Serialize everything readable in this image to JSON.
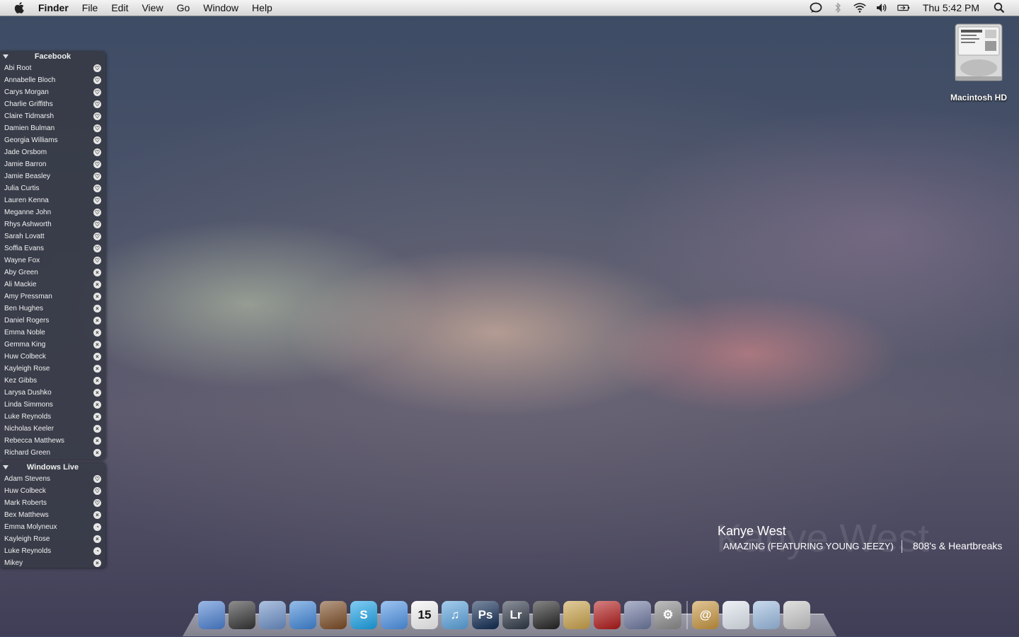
{
  "menubar": {
    "app_name": "Finder",
    "menus": [
      "File",
      "Edit",
      "View",
      "Go",
      "Window",
      "Help"
    ],
    "clock": "Thu 5:42 PM",
    "status_icons": [
      "chat-bubble-icon",
      "bluetooth-icon",
      "wifi-icon",
      "volume-icon",
      "battery-icon",
      "spotlight-search-icon"
    ]
  },
  "desktop": {
    "hd_label": "Macintosh HD"
  },
  "facebook": {
    "title": "Facebook",
    "contacts": [
      {
        "name": "Abi Root",
        "status": "online"
      },
      {
        "name": "Annabelle Bloch",
        "status": "online"
      },
      {
        "name": "Carys Morgan",
        "status": "online"
      },
      {
        "name": "Charlie Griffiths",
        "status": "online"
      },
      {
        "name": "Claire Tidmarsh",
        "status": "online"
      },
      {
        "name": "Damien Bulman",
        "status": "online"
      },
      {
        "name": "Georgia Williams",
        "status": "online"
      },
      {
        "name": "Jade Orsbom",
        "status": "online"
      },
      {
        "name": "Jamie Barron",
        "status": "online"
      },
      {
        "name": "Jamie Beasley",
        "status": "online"
      },
      {
        "name": "Julia Curtis",
        "status": "online"
      },
      {
        "name": "Lauren Kenna",
        "status": "online"
      },
      {
        "name": "Meganne John",
        "status": "online"
      },
      {
        "name": "Rhys Ashworth",
        "status": "online"
      },
      {
        "name": "Sarah Lovatt",
        "status": "online"
      },
      {
        "name": "Soffia Evans",
        "status": "online"
      },
      {
        "name": "Wayne Fox",
        "status": "online"
      },
      {
        "name": "Aby Green",
        "status": "offline"
      },
      {
        "name": "Ali Mackie",
        "status": "offline"
      },
      {
        "name": "Amy Pressman",
        "status": "offline"
      },
      {
        "name": "Ben Hughes",
        "status": "offline"
      },
      {
        "name": "Daniel Rogers",
        "status": "offline"
      },
      {
        "name": "Emma Noble",
        "status": "offline"
      },
      {
        "name": "Gemma King",
        "status": "offline"
      },
      {
        "name": "Huw Colbeck",
        "status": "offline"
      },
      {
        "name": "Kayleigh Rose",
        "status": "offline"
      },
      {
        "name": "Kez Gibbs",
        "status": "offline"
      },
      {
        "name": "Larysa Dushko",
        "status": "offline"
      },
      {
        "name": "Linda Simmons",
        "status": "offline"
      },
      {
        "name": "Luke Reynolds",
        "status": "offline"
      },
      {
        "name": "Nicholas Keeler",
        "status": "offline"
      },
      {
        "name": "Rebecca Matthews",
        "status": "offline"
      },
      {
        "name": "Richard Green",
        "status": "offline"
      }
    ]
  },
  "windows_live": {
    "title": "Windows Live",
    "contacts": [
      {
        "name": "Adam Stevens",
        "status": "online"
      },
      {
        "name": "Huw Colbeck",
        "status": "online"
      },
      {
        "name": "Mark Roberts",
        "status": "online"
      },
      {
        "name": "Bex Matthews",
        "status": "offline"
      },
      {
        "name": "Emma Molyneux",
        "status": "away"
      },
      {
        "name": "Kayleigh Rose",
        "status": "offline"
      },
      {
        "name": "Luke Reynolds",
        "status": "away"
      },
      {
        "name": "Mikey",
        "status": "offline"
      }
    ]
  },
  "now_playing": {
    "artist": "Kanye West",
    "song": "AMAZING (FEATURING YOUNG JEEZY)",
    "album": "808's & Heartbreaks"
  },
  "dock": {
    "apps": [
      {
        "icon": "finder-icon",
        "glyph": "",
        "color": "#4a7fd0"
      },
      {
        "icon": "dashboard-icon",
        "glyph": "",
        "color": "#333333"
      },
      {
        "icon": "mail-icon",
        "glyph": "",
        "color": "#6b8fc7"
      },
      {
        "icon": "safari-icon",
        "glyph": "",
        "color": "#3f86d8"
      },
      {
        "icon": "domo-icon",
        "glyph": "",
        "color": "#7a4a22"
      },
      {
        "icon": "skype-icon",
        "glyph": "S",
        "color": "#1aa3e8"
      },
      {
        "icon": "ichat-icon",
        "glyph": "",
        "color": "#4d93e6"
      },
      {
        "icon": "ical-icon",
        "glyph": "15",
        "color": "#f4f4f4"
      },
      {
        "icon": "itunes-icon",
        "glyph": "♫",
        "color": "#5ba3dd"
      },
      {
        "icon": "photoshop-icon",
        "glyph": "Ps",
        "color": "#0f2a52"
      },
      {
        "icon": "lightroom-icon",
        "glyph": "Lr",
        "color": "#2e3846"
      },
      {
        "icon": "aperture-icon",
        "glyph": "",
        "color": "#222222"
      },
      {
        "icon": "iphoto-icon",
        "glyph": "",
        "color": "#c9a24a"
      },
      {
        "icon": "front-row-icon",
        "glyph": "",
        "color": "#b01818"
      },
      {
        "icon": "automator-icon",
        "glyph": "",
        "color": "#6e78a0"
      },
      {
        "icon": "system-preferences-icon",
        "glyph": "⚙",
        "color": "#8a8a8a"
      }
    ],
    "stacks": [
      {
        "icon": "address-book-icon",
        "glyph": "@",
        "color": "#c7953f"
      },
      {
        "icon": "documents-stack-icon",
        "glyph": "",
        "color": "#dfe6ee"
      },
      {
        "icon": "downloads-folder-icon",
        "glyph": "",
        "color": "#9bbbe0"
      },
      {
        "icon": "trash-icon",
        "glyph": "",
        "color": "#c8c8c8"
      }
    ]
  }
}
